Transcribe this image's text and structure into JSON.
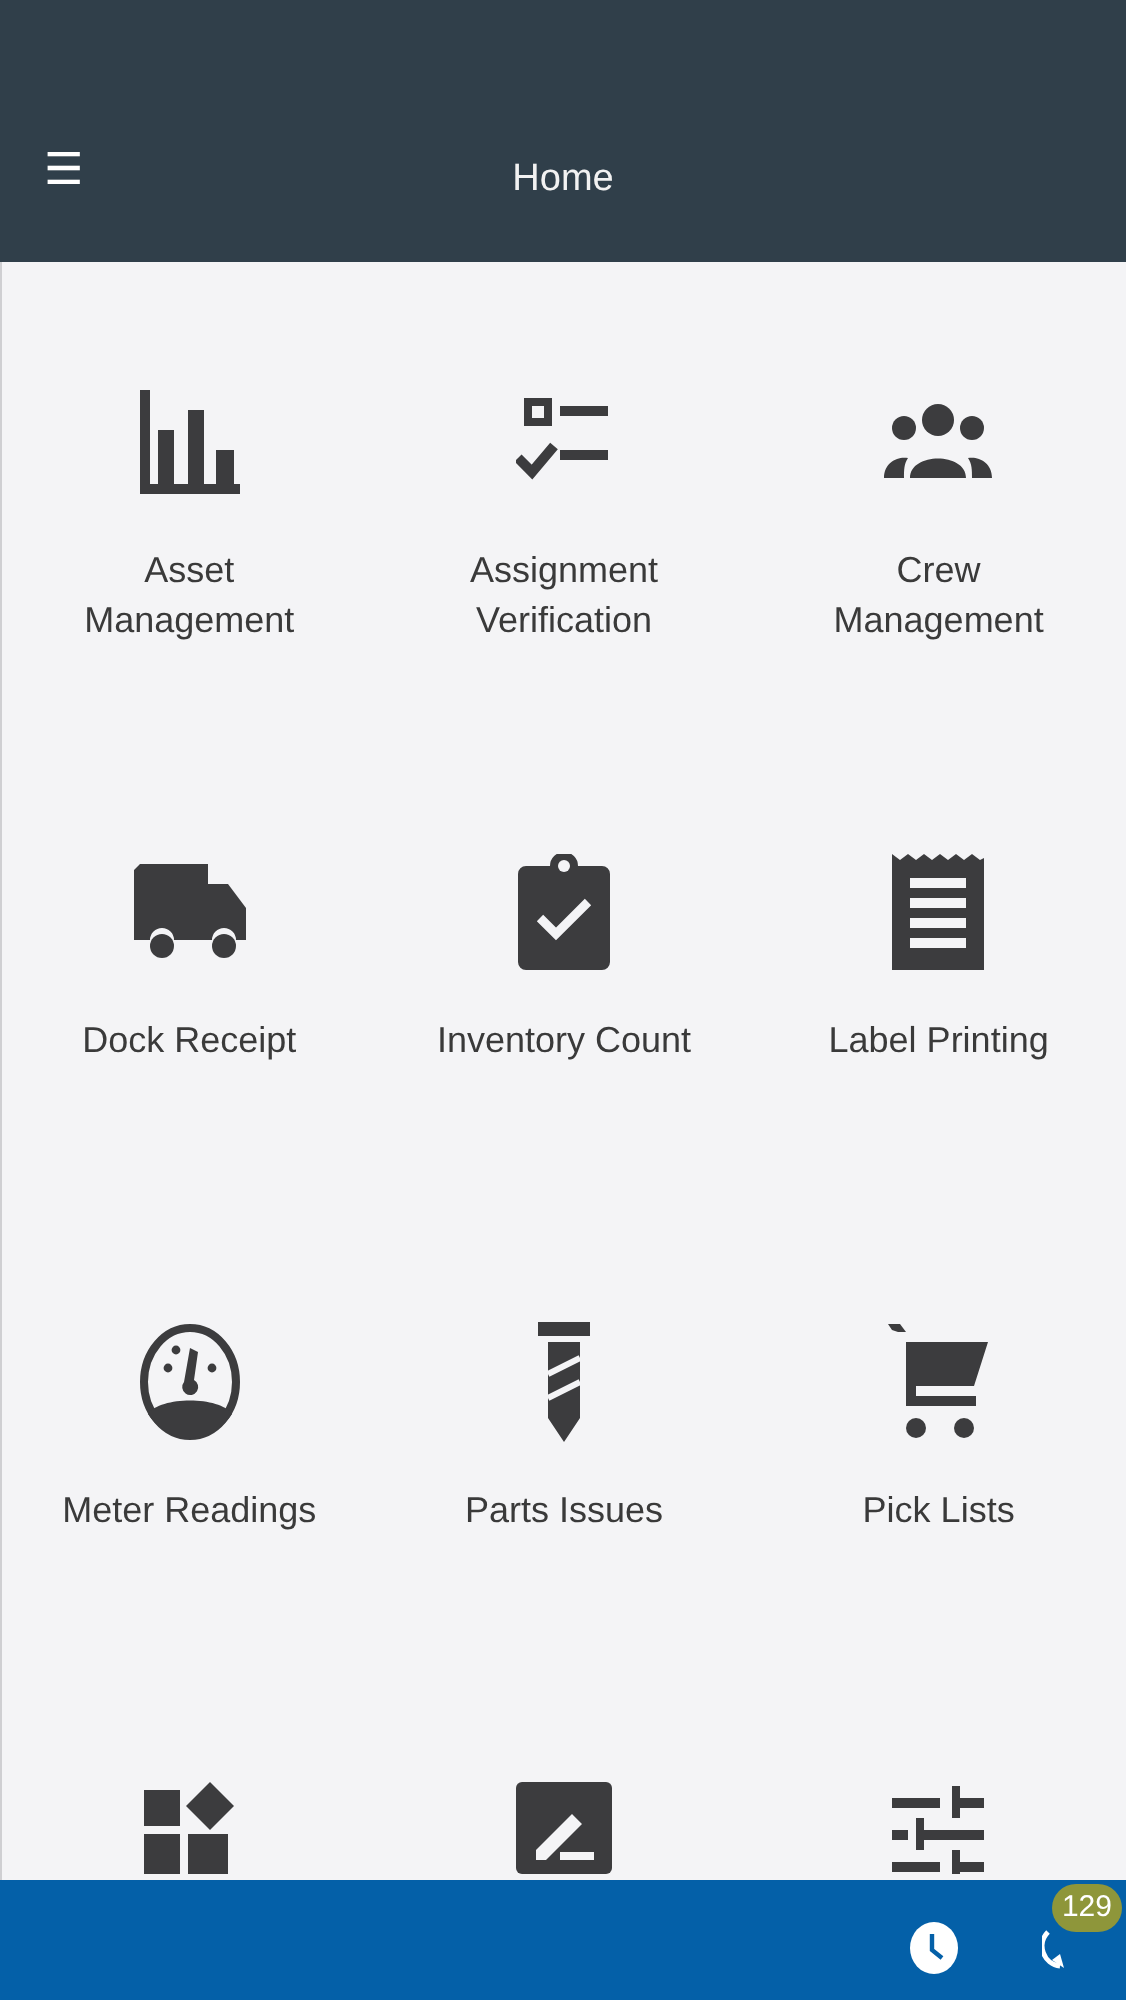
{
  "header": {
    "menu_glyph": "☰",
    "title": "Home"
  },
  "tiles": [
    {
      "kind": "labeled",
      "label": "Asset Management"
    },
    {
      "kind": "labeled",
      "label": "Assignment Verification"
    },
    {
      "kind": "labeled",
      "label": "Crew Management"
    },
    {
      "kind": "labeled",
      "label": "Dock Receipt"
    },
    {
      "kind": "labeled",
      "label": "Inventory Count"
    },
    {
      "kind": "labeled",
      "label": "Label Printing"
    },
    {
      "kind": "labeled",
      "label": "Meter Readings"
    },
    {
      "kind": "labeled",
      "label": "Parts Issues"
    },
    {
      "kind": "labeled",
      "label": "Pick Lists"
    },
    {
      "kind": "partial"
    },
    {
      "kind": "partial"
    },
    {
      "kind": "partial"
    }
  ],
  "bottom_bar": {
    "sync_badge": "129"
  }
}
